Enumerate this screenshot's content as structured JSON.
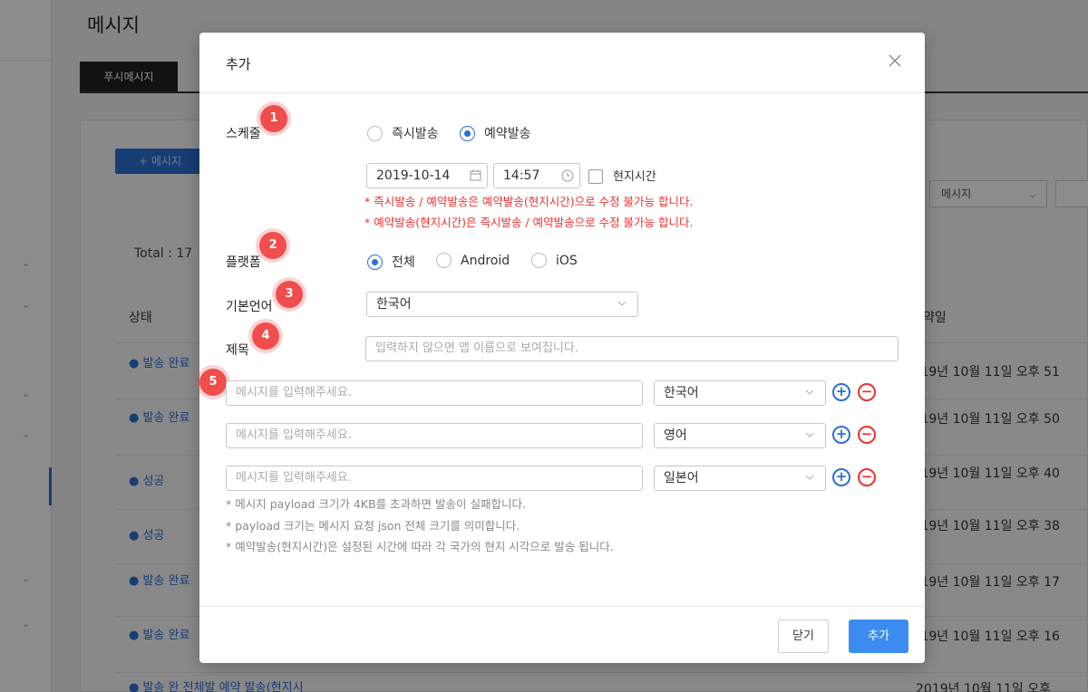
{
  "background": {
    "page_title": "메시지",
    "tab_label": "푸시메시지",
    "add_button": "+ 메시지",
    "filter_select": "메시지",
    "total": "Total : 17",
    "columns": {
      "status": "상태",
      "date": "약일"
    },
    "rows": [
      {
        "status": "● 발송 완료",
        "date": ")19년 10월 11일 오후 51"
      },
      {
        "status": "● 발송 완료",
        "date": ")19년 10월 11일 오후 50"
      },
      {
        "status": "● 성공",
        "date": ")19년 10월 11일 오후 40"
      },
      {
        "status": "● 성공",
        "date": ")19년 10월 11일 오후 38"
      },
      {
        "status": "● 발송 완료",
        "date": ")19년 10월 11일 오후 17"
      },
      {
        "status": "● 발송 완료",
        "date": ")19년 10월 11일 오후 16"
      },
      {
        "status": "● 발송 완 전체발 예약 발송(현지시",
        "date": "2019년 10월 11일 오후"
      }
    ]
  },
  "modal": {
    "title": "추가",
    "close_icon": "close-icon",
    "schedule": {
      "label": "스케줄",
      "badge": "1",
      "options": [
        "즉시발송",
        "예약발송"
      ],
      "selected": "예약발송",
      "date": "2019-10-14",
      "time": "14:57",
      "local_time_label": "현지시간",
      "local_time_checked": false,
      "notes": [
        "* 즉시발송 / 예약발송은 예약발송(현지시간)으로 수정 불가능 합니다.",
        "* 예약발송(현지시간)은 즉시발송 / 예약발송으로 수정 불가능 합니다."
      ]
    },
    "platform": {
      "label": "플랫폼",
      "badge": "2",
      "options": [
        "전체",
        "Android",
        "iOS"
      ],
      "selected": "전체"
    },
    "default_language": {
      "label": "기본언어",
      "badge": "3",
      "value": "한국어"
    },
    "subject": {
      "label": "제목",
      "badge": "4",
      "placeholder": "입력하지 않으면 앱 이름으로 보여집니다."
    },
    "messages": {
      "badge": "5",
      "rows": [
        {
          "placeholder": "메시지를 입력해주세요.",
          "language": "한국어"
        },
        {
          "placeholder": "메시지를 입력해주세요.",
          "language": "영어"
        },
        {
          "placeholder": "메시지를 입력해주세요.",
          "language": "일본어"
        }
      ],
      "notes": [
        "* 메시지 payload 크기가 4KB를 초과하면 발송이 실패합니다.",
        "* payload 크기는 메시지 요청 json 전체 크기를 의미합니다.",
        "* 예약발송(현지시간)은 설정된 시간에 따라 각 국가의 현지 시각으로 발송 됩니다."
      ]
    },
    "footer": {
      "close_label": "닫기",
      "add_label": "추가"
    },
    "colors": {
      "accent": "#2b6fd6",
      "primary_button": "#3c8cf0",
      "error": "#f03030",
      "badge": "#f04d4d"
    }
  }
}
